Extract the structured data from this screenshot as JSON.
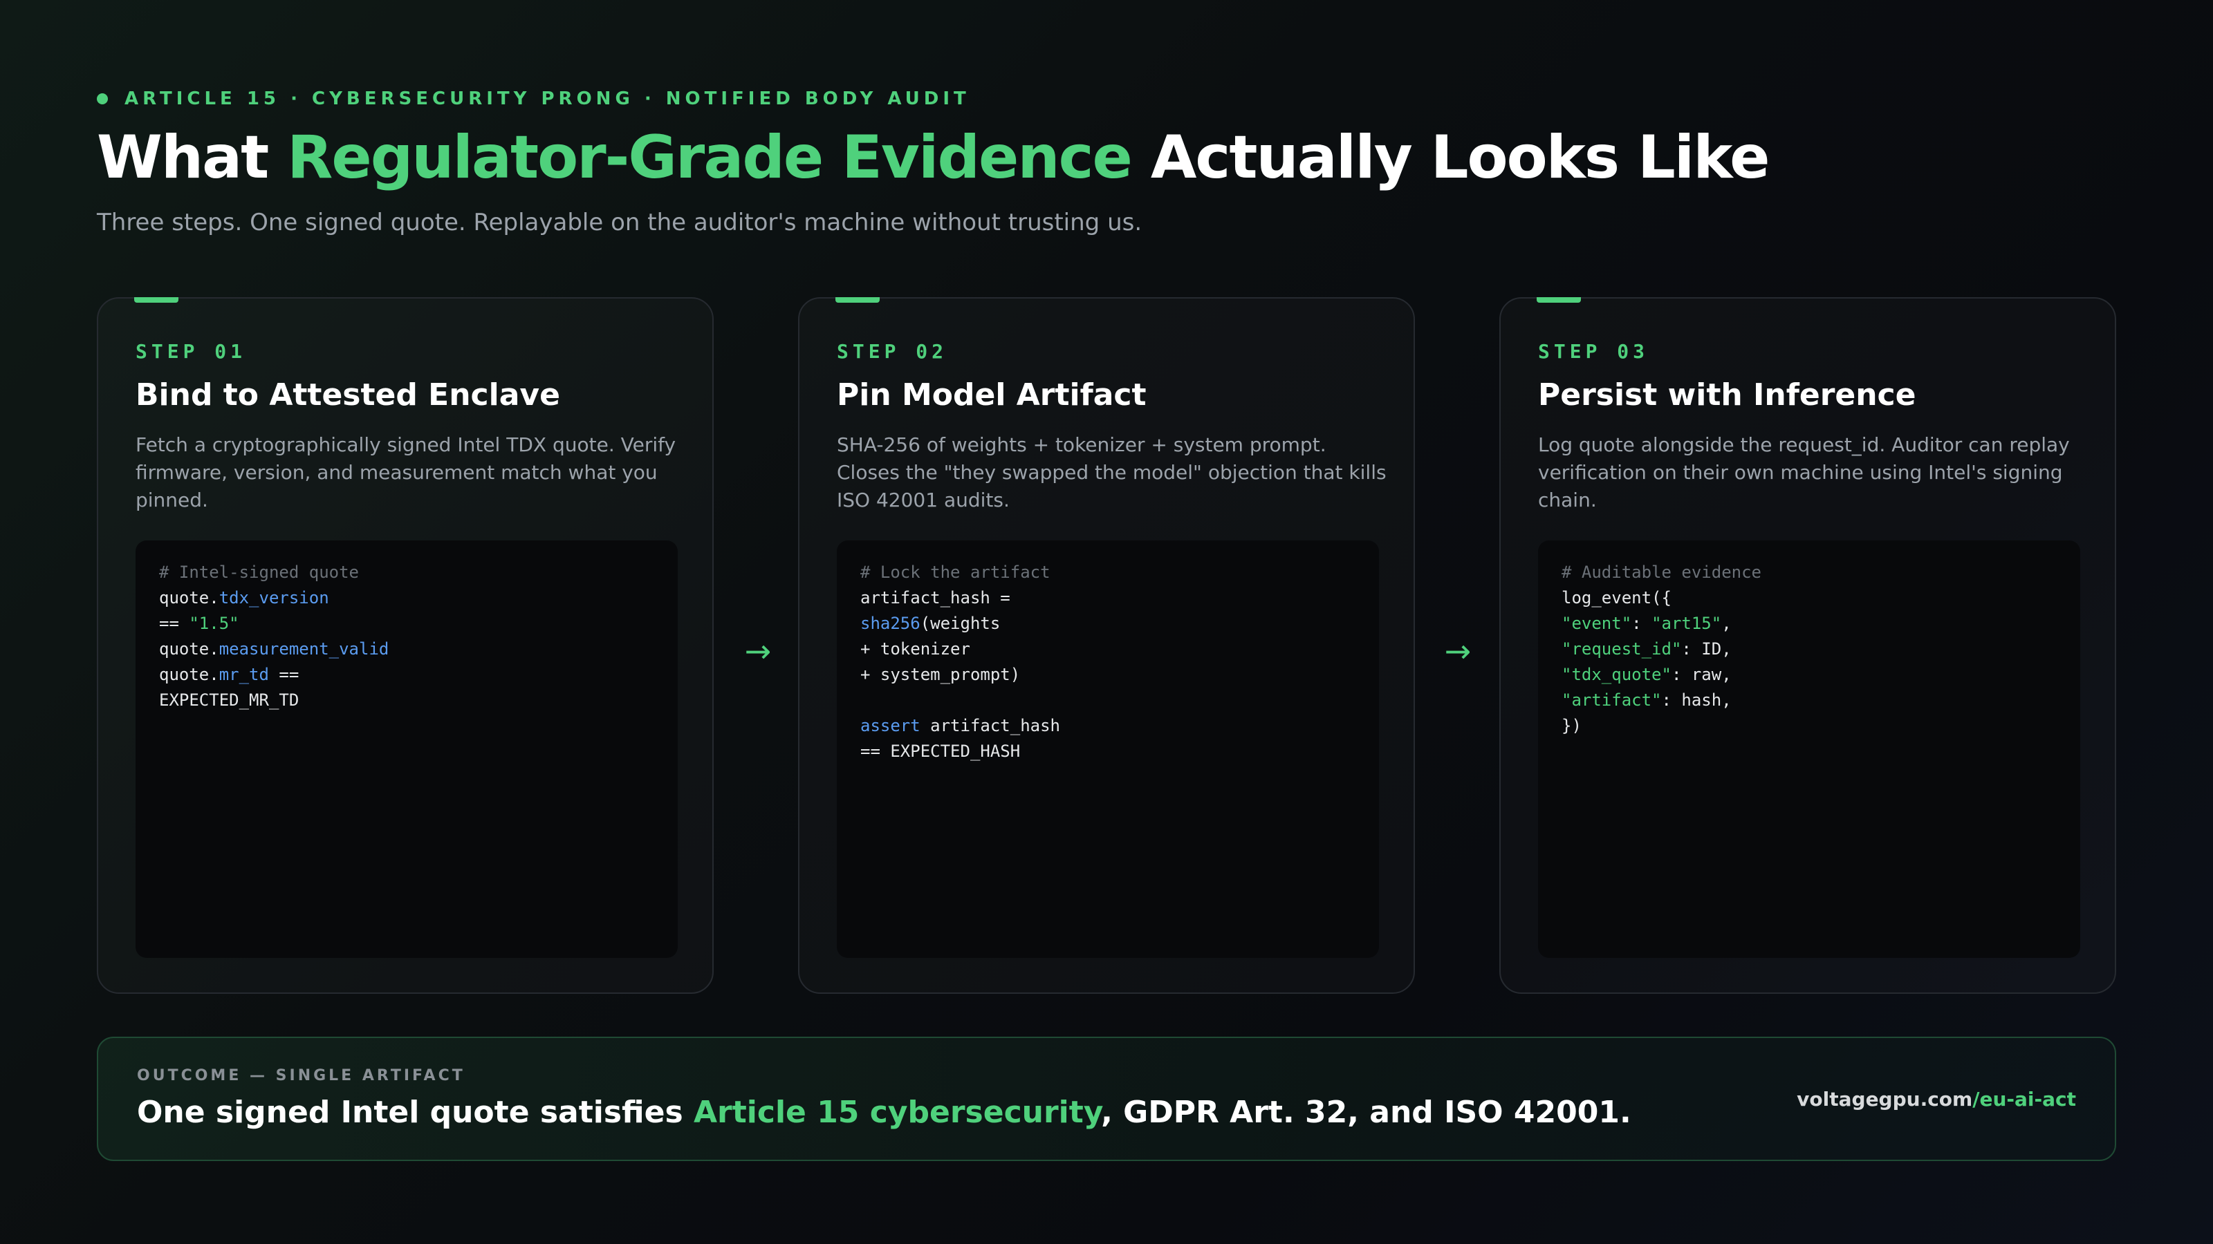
{
  "header": {
    "eyebrow": "ARTICLE 15 · CYBERSECURITY PRONG · NOTIFIED BODY AUDIT",
    "title_pre": "What ",
    "title_accent": "Regulator-Grade Evidence",
    "title_post": " Actually Looks Like",
    "subtitle": "Three steps. One signed quote. Replayable on the auditor's machine without trusting us."
  },
  "steps": [
    {
      "label": "STEP 01",
      "title": "Bind to Attested Enclave",
      "description": "Fetch a cryptographically signed Intel TDX quote. Verify firmware, version, and measurement match what you pinned.",
      "code": [
        [
          {
            "t": "# Intel-signed quote",
            "c": "comment"
          }
        ],
        [
          {
            "t": "quote.",
            "c": ""
          },
          {
            "t": "tdx_version",
            "c": "blue"
          }
        ],
        [
          {
            "t": "== ",
            "c": ""
          },
          {
            "t": "\"1.5\"",
            "c": "green"
          }
        ],
        [
          {
            "t": "quote.",
            "c": ""
          },
          {
            "t": "measurement_valid",
            "c": "blue"
          }
        ],
        [
          {
            "t": "quote.",
            "c": ""
          },
          {
            "t": "mr_td",
            "c": "blue"
          },
          {
            "t": " ==",
            "c": ""
          }
        ],
        [
          {
            "t": "EXPECTED_MR_TD",
            "c": ""
          }
        ]
      ]
    },
    {
      "label": "STEP 02",
      "title": "Pin Model Artifact",
      "description": "SHA-256 of weights + tokenizer + system prompt. Closes the \"they swapped the model\" objection that kills ISO 42001 audits.",
      "code": [
        [
          {
            "t": "# Lock the artifact",
            "c": "comment"
          }
        ],
        [
          {
            "t": "artifact_hash =",
            "c": ""
          }
        ],
        [
          {
            "t": "sha256",
            "c": "blue"
          },
          {
            "t": "(weights",
            "c": ""
          }
        ],
        [
          {
            "t": "+ tokenizer",
            "c": ""
          }
        ],
        [
          {
            "t": "+ system_prompt)",
            "c": ""
          }
        ],
        [],
        [
          {
            "t": "assert",
            "c": "blue"
          },
          {
            "t": " artifact_hash",
            "c": ""
          }
        ],
        [
          {
            "t": "== EXPECTED_HASH",
            "c": ""
          }
        ]
      ]
    },
    {
      "label": "STEP 03",
      "title": "Persist with Inference",
      "description": "Log quote alongside the request_id. Auditor can replay verification on their own machine using Intel's signing chain.",
      "code": [
        [
          {
            "t": "# Auditable evidence",
            "c": "comment"
          }
        ],
        [
          {
            "t": "log_event({",
            "c": ""
          }
        ],
        [
          {
            "t": "\"event\"",
            "c": "green"
          },
          {
            "t": ": ",
            "c": ""
          },
          {
            "t": "\"art15\"",
            "c": "green"
          },
          {
            "t": ",",
            "c": ""
          }
        ],
        [
          {
            "t": "\"request_id\"",
            "c": "green"
          },
          {
            "t": ": ID,",
            "c": ""
          }
        ],
        [
          {
            "t": "\"tdx_quote\"",
            "c": "green"
          },
          {
            "t": ": raw,",
            "c": ""
          }
        ],
        [
          {
            "t": "\"artifact\"",
            "c": "green"
          },
          {
            "t": ": hash,",
            "c": ""
          }
        ],
        [
          {
            "t": "})",
            "c": ""
          }
        ]
      ]
    }
  ],
  "arrows": [
    "→",
    "→"
  ],
  "outcome": {
    "label": "OUTCOME — SINGLE ARTIFACT",
    "statement_pre": "One signed Intel quote satisfies ",
    "statement_accent": "Article 15 cybersecurity",
    "statement_post": ", GDPR Art. 32, and ISO 42001.",
    "url_domain": "voltagegpu.com",
    "url_path": "/eu-ai-act"
  },
  "colors": {
    "accent": "#4fd17c",
    "code_keyword": "#5b9cf0",
    "background": "#0b0e10"
  }
}
